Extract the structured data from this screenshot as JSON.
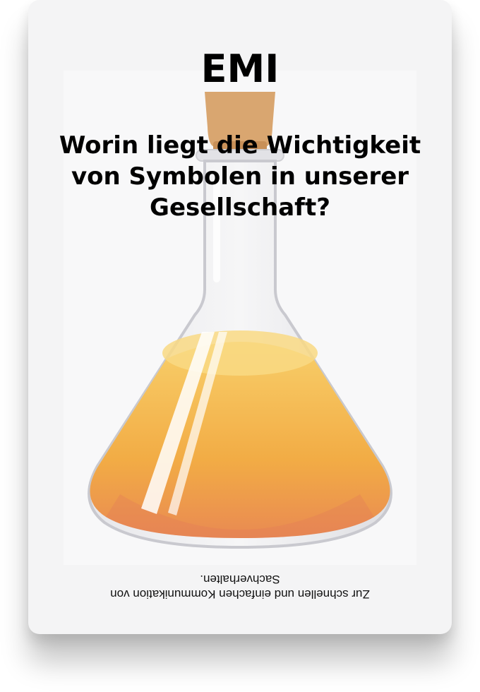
{
  "card": {
    "brand": "EMI",
    "question": "Worin liegt die Wichtigkeit von Symbolen in unserer Gesellschaft?",
    "answer": "Zur schnellen und einfachen Kommunikation von Sachverhalten.",
    "illustration": {
      "icon": "flask-with-cork-icon",
      "liquid_color": "#f3b24a",
      "cork_color": "#d9a670"
    }
  }
}
